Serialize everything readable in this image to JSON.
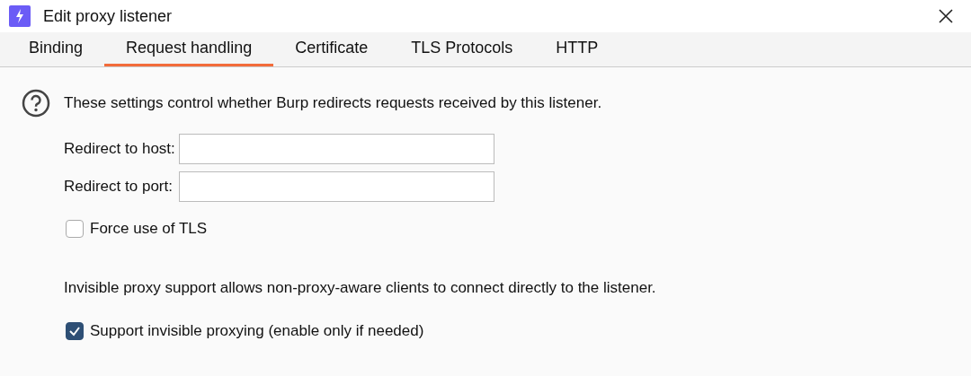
{
  "window": {
    "title": "Edit proxy listener"
  },
  "tabs": [
    {
      "label": "Binding",
      "selected": false
    },
    {
      "label": "Request handling",
      "selected": true
    },
    {
      "label": "Certificate",
      "selected": false
    },
    {
      "label": "TLS Protocols",
      "selected": false
    },
    {
      "label": "HTTP",
      "selected": false
    }
  ],
  "intro": "These settings control whether Burp redirects requests received by this listener.",
  "fields": [
    {
      "label": "Redirect to host:"
    },
    {
      "label": "Redirect to port:"
    }
  ],
  "force_tls": {
    "label": "Force use of TLS",
    "checked": false
  },
  "invisible_info": "Invisible proxy support allows non-proxy-aware clients to connect directly to the listener.",
  "invisible": {
    "label": "Support invisible proxying (enable only if needed)",
    "checked": true
  }
}
